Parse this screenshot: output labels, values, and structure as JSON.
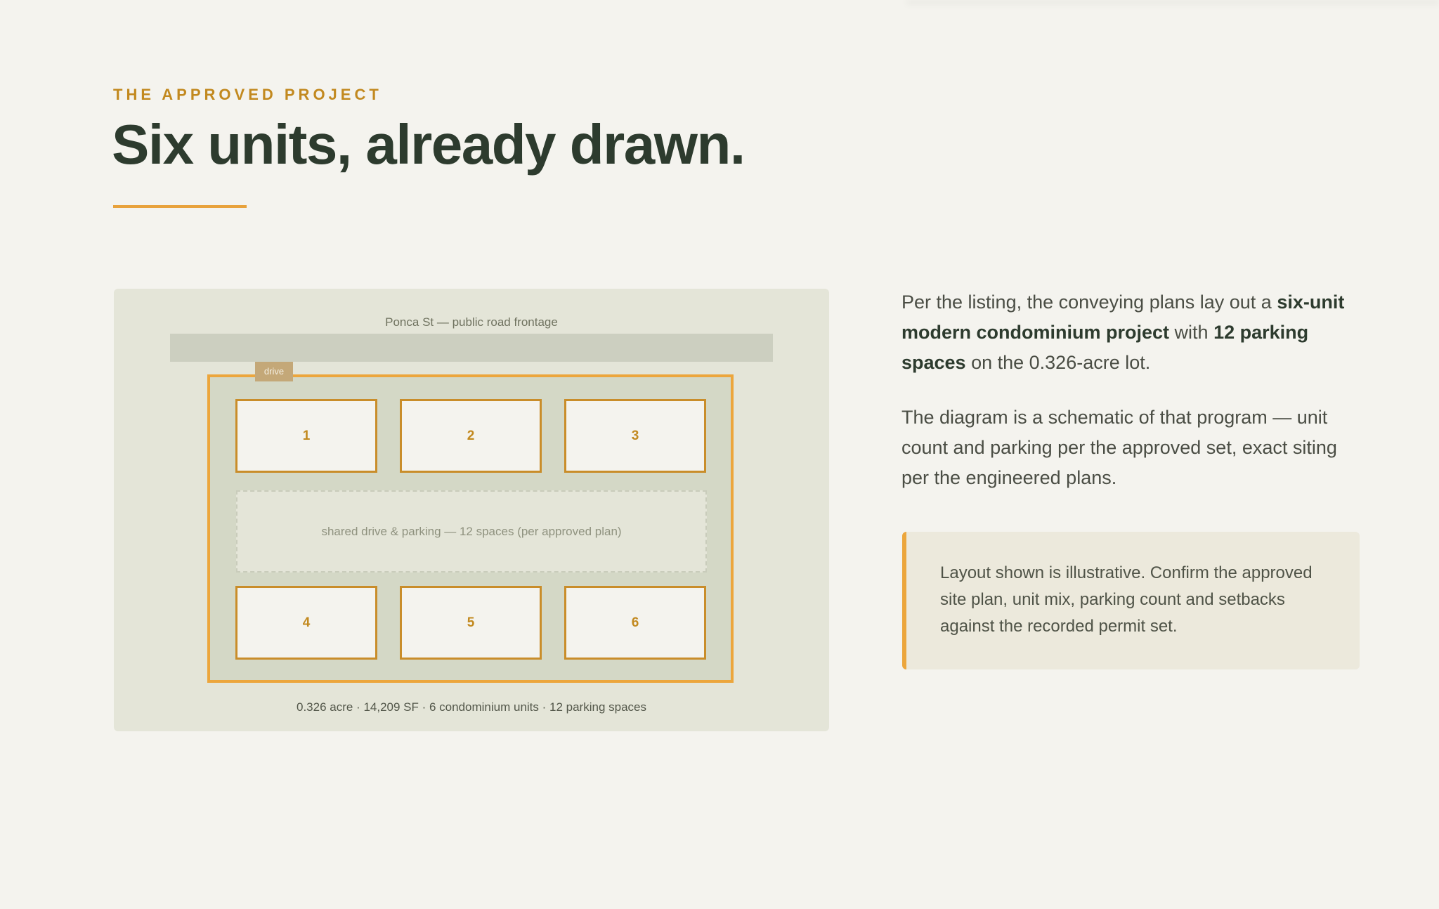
{
  "header": {
    "eyebrow": "THE APPROVED PROJECT",
    "title": "Six units, already drawn."
  },
  "diagram": {
    "road_label": "Ponca St — public road frontage",
    "drive_tag": "drive",
    "units": [
      "1",
      "2",
      "3",
      "4",
      "5",
      "6"
    ],
    "shared_drive_label": "shared drive & parking — 12 spaces (per approved plan)",
    "caption": "0.326 acre · 14,209 SF · 6 condominium units · 12 parking spaces"
  },
  "body": {
    "p1": {
      "t1": "Per the listing, the conveying plans lay out a ",
      "b1": "six-unit modern condominium project",
      "t2": " with ",
      "b2": "12 parking spaces",
      "t3": " on the 0.326-acre lot."
    },
    "p2": "The diagram is a schematic of that program — unit count and parking per the approved set, exact siting per the engineered plans."
  },
  "callout": {
    "text": "Layout shown is illustrative. Confirm the approved site plan, unit mix, parking count and setbacks against the recorded permit set."
  },
  "colors": {
    "accent": "#e8a23c",
    "heading": "#2d3b2e",
    "eyebrow": "#c2891f",
    "background": "#f4f3ee"
  }
}
